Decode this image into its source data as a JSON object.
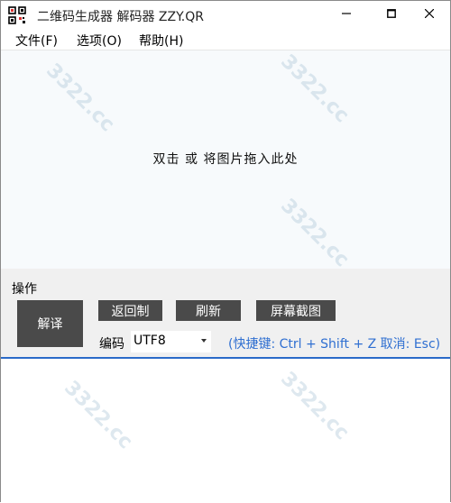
{
  "window": {
    "title": "二维码生成器 解码器 ZZY.QR",
    "controls": {
      "minimize_icon": "minimize-icon",
      "maximize_icon": "maximize-icon",
      "close_icon": "close-icon"
    }
  },
  "menu": {
    "items": [
      {
        "label": "文件(F)"
      },
      {
        "label": "选项(O)"
      },
      {
        "label": "帮助(H)"
      }
    ]
  },
  "dropzone": {
    "hint": "双击 或 将图片拖入此处"
  },
  "operations": {
    "label": "操作",
    "buttons": {
      "decode": "解译",
      "back_copy": "返回制",
      "refresh": "刷新",
      "screenshot": "屏幕截图"
    },
    "encoding": {
      "label": "编码",
      "selected": "UTF8"
    },
    "hotkey_hint": "(快捷键: Ctrl + Shift + Z  取消: Esc)"
  },
  "result": {
    "text": ""
  },
  "colors": {
    "accent_blue": "#2a6ac8",
    "button_dark": "#4a4a4a",
    "panel_gray": "#f0f0f0",
    "hotkey_text": "#2f6fd1"
  }
}
